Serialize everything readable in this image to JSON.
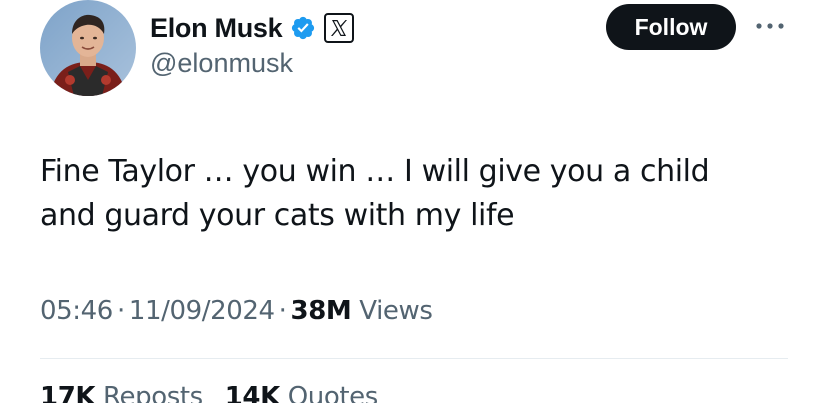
{
  "author": {
    "display_name": "Elon Musk",
    "handle": "@elonmusk",
    "avatar_icon": "elon-musk-avatar",
    "verified_badge_color": "#1d9bf0",
    "affiliate_badge_icon": "x-logo-icon"
  },
  "follow_button": {
    "label": "Follow",
    "background": "#0f1419"
  },
  "more_icon": "more-horizontal-icon",
  "tweet": {
    "line1": "Fine Taylor … you win … I will give you a child",
    "line2": "and guard your cats with my life"
  },
  "meta": {
    "time": "05:46",
    "separator": "·",
    "date": "11/09/2024",
    "views_count": "38M",
    "views_label": "Views"
  },
  "stats": {
    "reposts_count": "17K",
    "reposts_label": "Reposts",
    "quotes_count": "14K",
    "quotes_label": "Quotes"
  }
}
